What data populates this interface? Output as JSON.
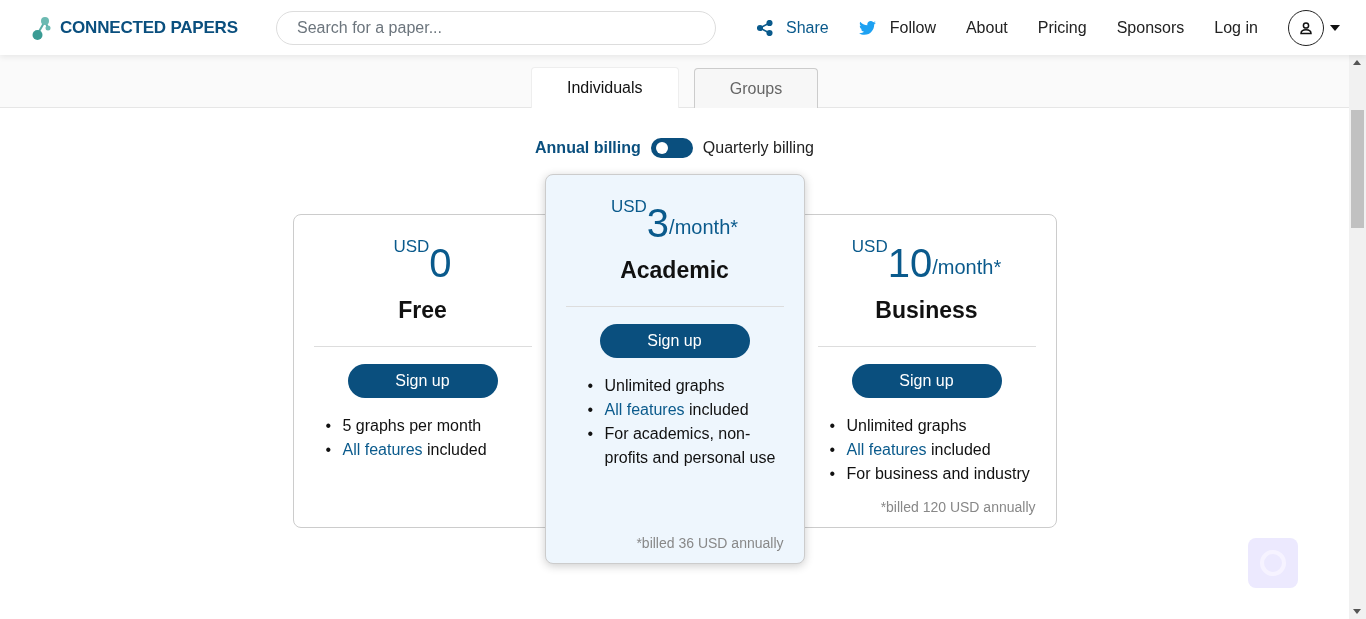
{
  "header": {
    "logo": "CONNECTED PAPERS",
    "search": {
      "placeholder": "Search for a paper..."
    },
    "nav": [
      {
        "kind": "share",
        "label": "Share"
      },
      {
        "kind": "follow",
        "label": "Follow"
      },
      {
        "kind": "plain",
        "label": "About"
      },
      {
        "kind": "plain",
        "label": "Pricing"
      },
      {
        "kind": "plain",
        "label": "Sponsors"
      },
      {
        "kind": "plain",
        "label": "Log in"
      }
    ]
  },
  "tabs": [
    {
      "label": "Individuals",
      "selected": true
    },
    {
      "label": "Groups",
      "selected": false
    }
  ],
  "billing": [
    {
      "label": "Annual billing",
      "selected": true
    },
    {
      "label": "Quarterly billing",
      "selected": false
    }
  ],
  "plans": [
    {
      "currency": "USD",
      "amount": "0",
      "name": "Free",
      "button": "Sign up",
      "featured": false,
      "features": [
        {
          "marker": "•",
          "text": "5 graphs per month"
        },
        {
          "marker": "•",
          "link": "All features",
          "text": "included"
        }
      ]
    },
    {
      "currency": "USD",
      "amount": "3",
      "period": "/month*",
      "name": "Academic",
      "button": "Sign up",
      "featured": true,
      "features": [
        {
          "marker": "•",
          "text": "Unlimited graphs"
        },
        {
          "marker": "•",
          "link": "All features",
          "text": "included"
        },
        {
          "marker": "•",
          "text": "For academics, non-profits and personal use"
        }
      ],
      "note": "*billed 36 USD annually"
    },
    {
      "currency": "USD",
      "amount": "10",
      "period": "/month*",
      "name": "Business",
      "button": "Sign up",
      "featured": false,
      "features": [
        {
          "marker": "•",
          "text": "Unlimited graphs"
        },
        {
          "marker": "•",
          "link": "All features",
          "text": "included"
        },
        {
          "marker": "•",
          "text": "For business and industry"
        }
      ],
      "note": "*billed 120 USD annually"
    }
  ]
}
